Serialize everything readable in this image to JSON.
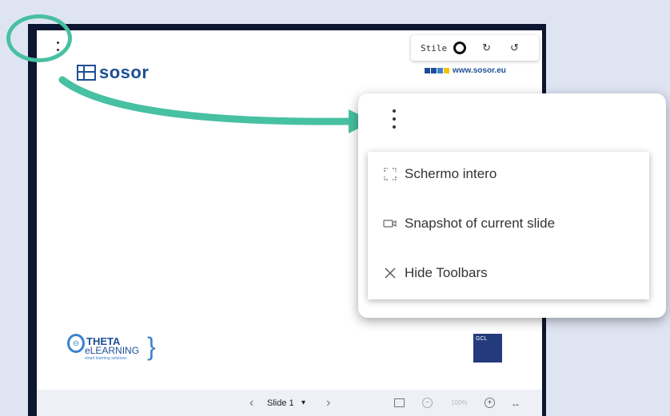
{
  "toolbar": {
    "style_label": "Stile",
    "redo_glyph": "↻",
    "undo_glyph": "↺"
  },
  "slide": {
    "logo_left_text": "sosor",
    "logo_right_text": "www.sosor.eu",
    "logo_right_colors": [
      "#1e4f96",
      "#1e4f96",
      "#3a82d0",
      "#f2c400"
    ],
    "theta_line1": "THETA",
    "theta_line2": "eLEARNING",
    "theta_line3": "smart learning solutions",
    "gcl_text": "GCL"
  },
  "bottom_bar": {
    "slide_label": "Slide 1",
    "zoom": "100%"
  },
  "menu": {
    "items": [
      {
        "label": "Schermo intero",
        "icon": "fullscreen-icon"
      },
      {
        "label": "Snapshot of current slide",
        "icon": "camera-icon"
      },
      {
        "label": "Hide Toolbars",
        "icon": "close-icon"
      }
    ]
  },
  "colors": {
    "background": "#dfe4f2",
    "frame": "#0c1630",
    "accent": "#48c0a2",
    "brand": "#1e4f96"
  }
}
